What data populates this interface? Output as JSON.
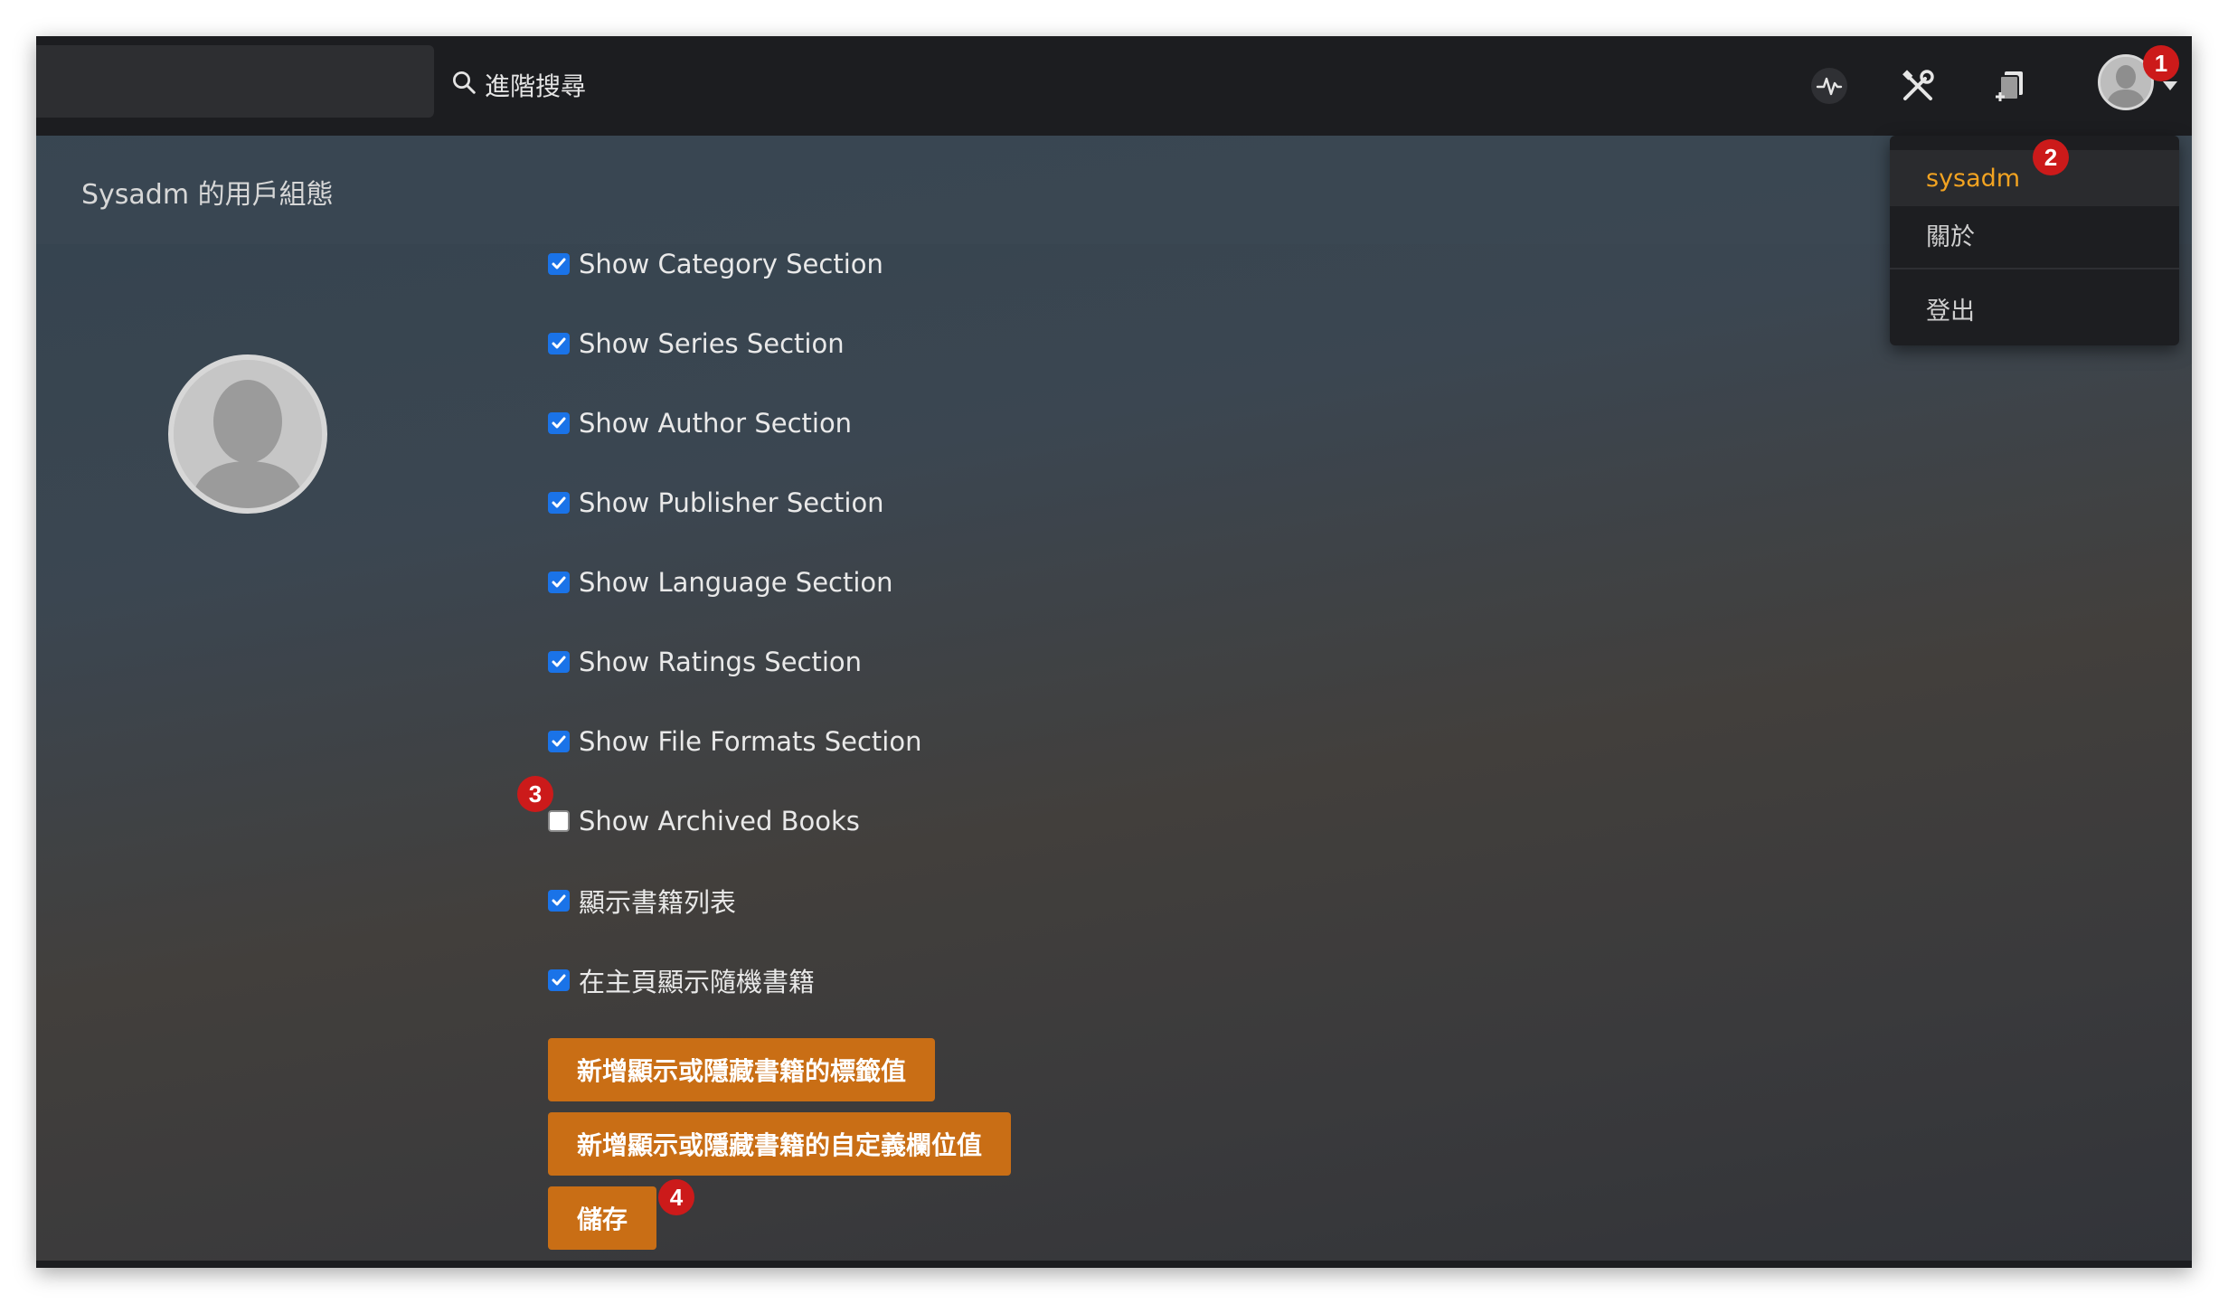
{
  "topbar": {
    "search_label": "進階搜尋",
    "icons": [
      "activity-icon",
      "tools-icon",
      "add-book-icon"
    ]
  },
  "page": {
    "title": "Sysadm 的用戶組態"
  },
  "settings": {
    "checkboxes": [
      {
        "label": "Show Category Section",
        "checked": true
      },
      {
        "label": "Show Series Section",
        "checked": true
      },
      {
        "label": "Show Author Section",
        "checked": true
      },
      {
        "label": "Show Publisher Section",
        "checked": true
      },
      {
        "label": "Show Language Section",
        "checked": true
      },
      {
        "label": "Show Ratings Section",
        "checked": true
      },
      {
        "label": "Show File Formats Section",
        "checked": true
      },
      {
        "label": "Show Archived Books",
        "checked": false
      },
      {
        "label": "顯示書籍列表",
        "checked": true
      },
      {
        "label": "在主頁顯示隨機書籍",
        "checked": true
      }
    ],
    "buttons": {
      "tag_visibility": "新增顯示或隱藏書籍的標籤值",
      "custom_column_visibility": "新增顯示或隱藏書籍的自定義欄位值",
      "save": "儲存"
    }
  },
  "dropdown": {
    "items": [
      {
        "label": "sysadm"
      },
      {
        "label": "關於"
      },
      {
        "label": "登出"
      }
    ]
  },
  "callouts": [
    "1",
    "2",
    "3",
    "4"
  ],
  "colors": {
    "accent": "#c96e15",
    "active_menu": "#f2a321",
    "checkbox": "#1a73e8",
    "badge": "#cc1a1a"
  }
}
